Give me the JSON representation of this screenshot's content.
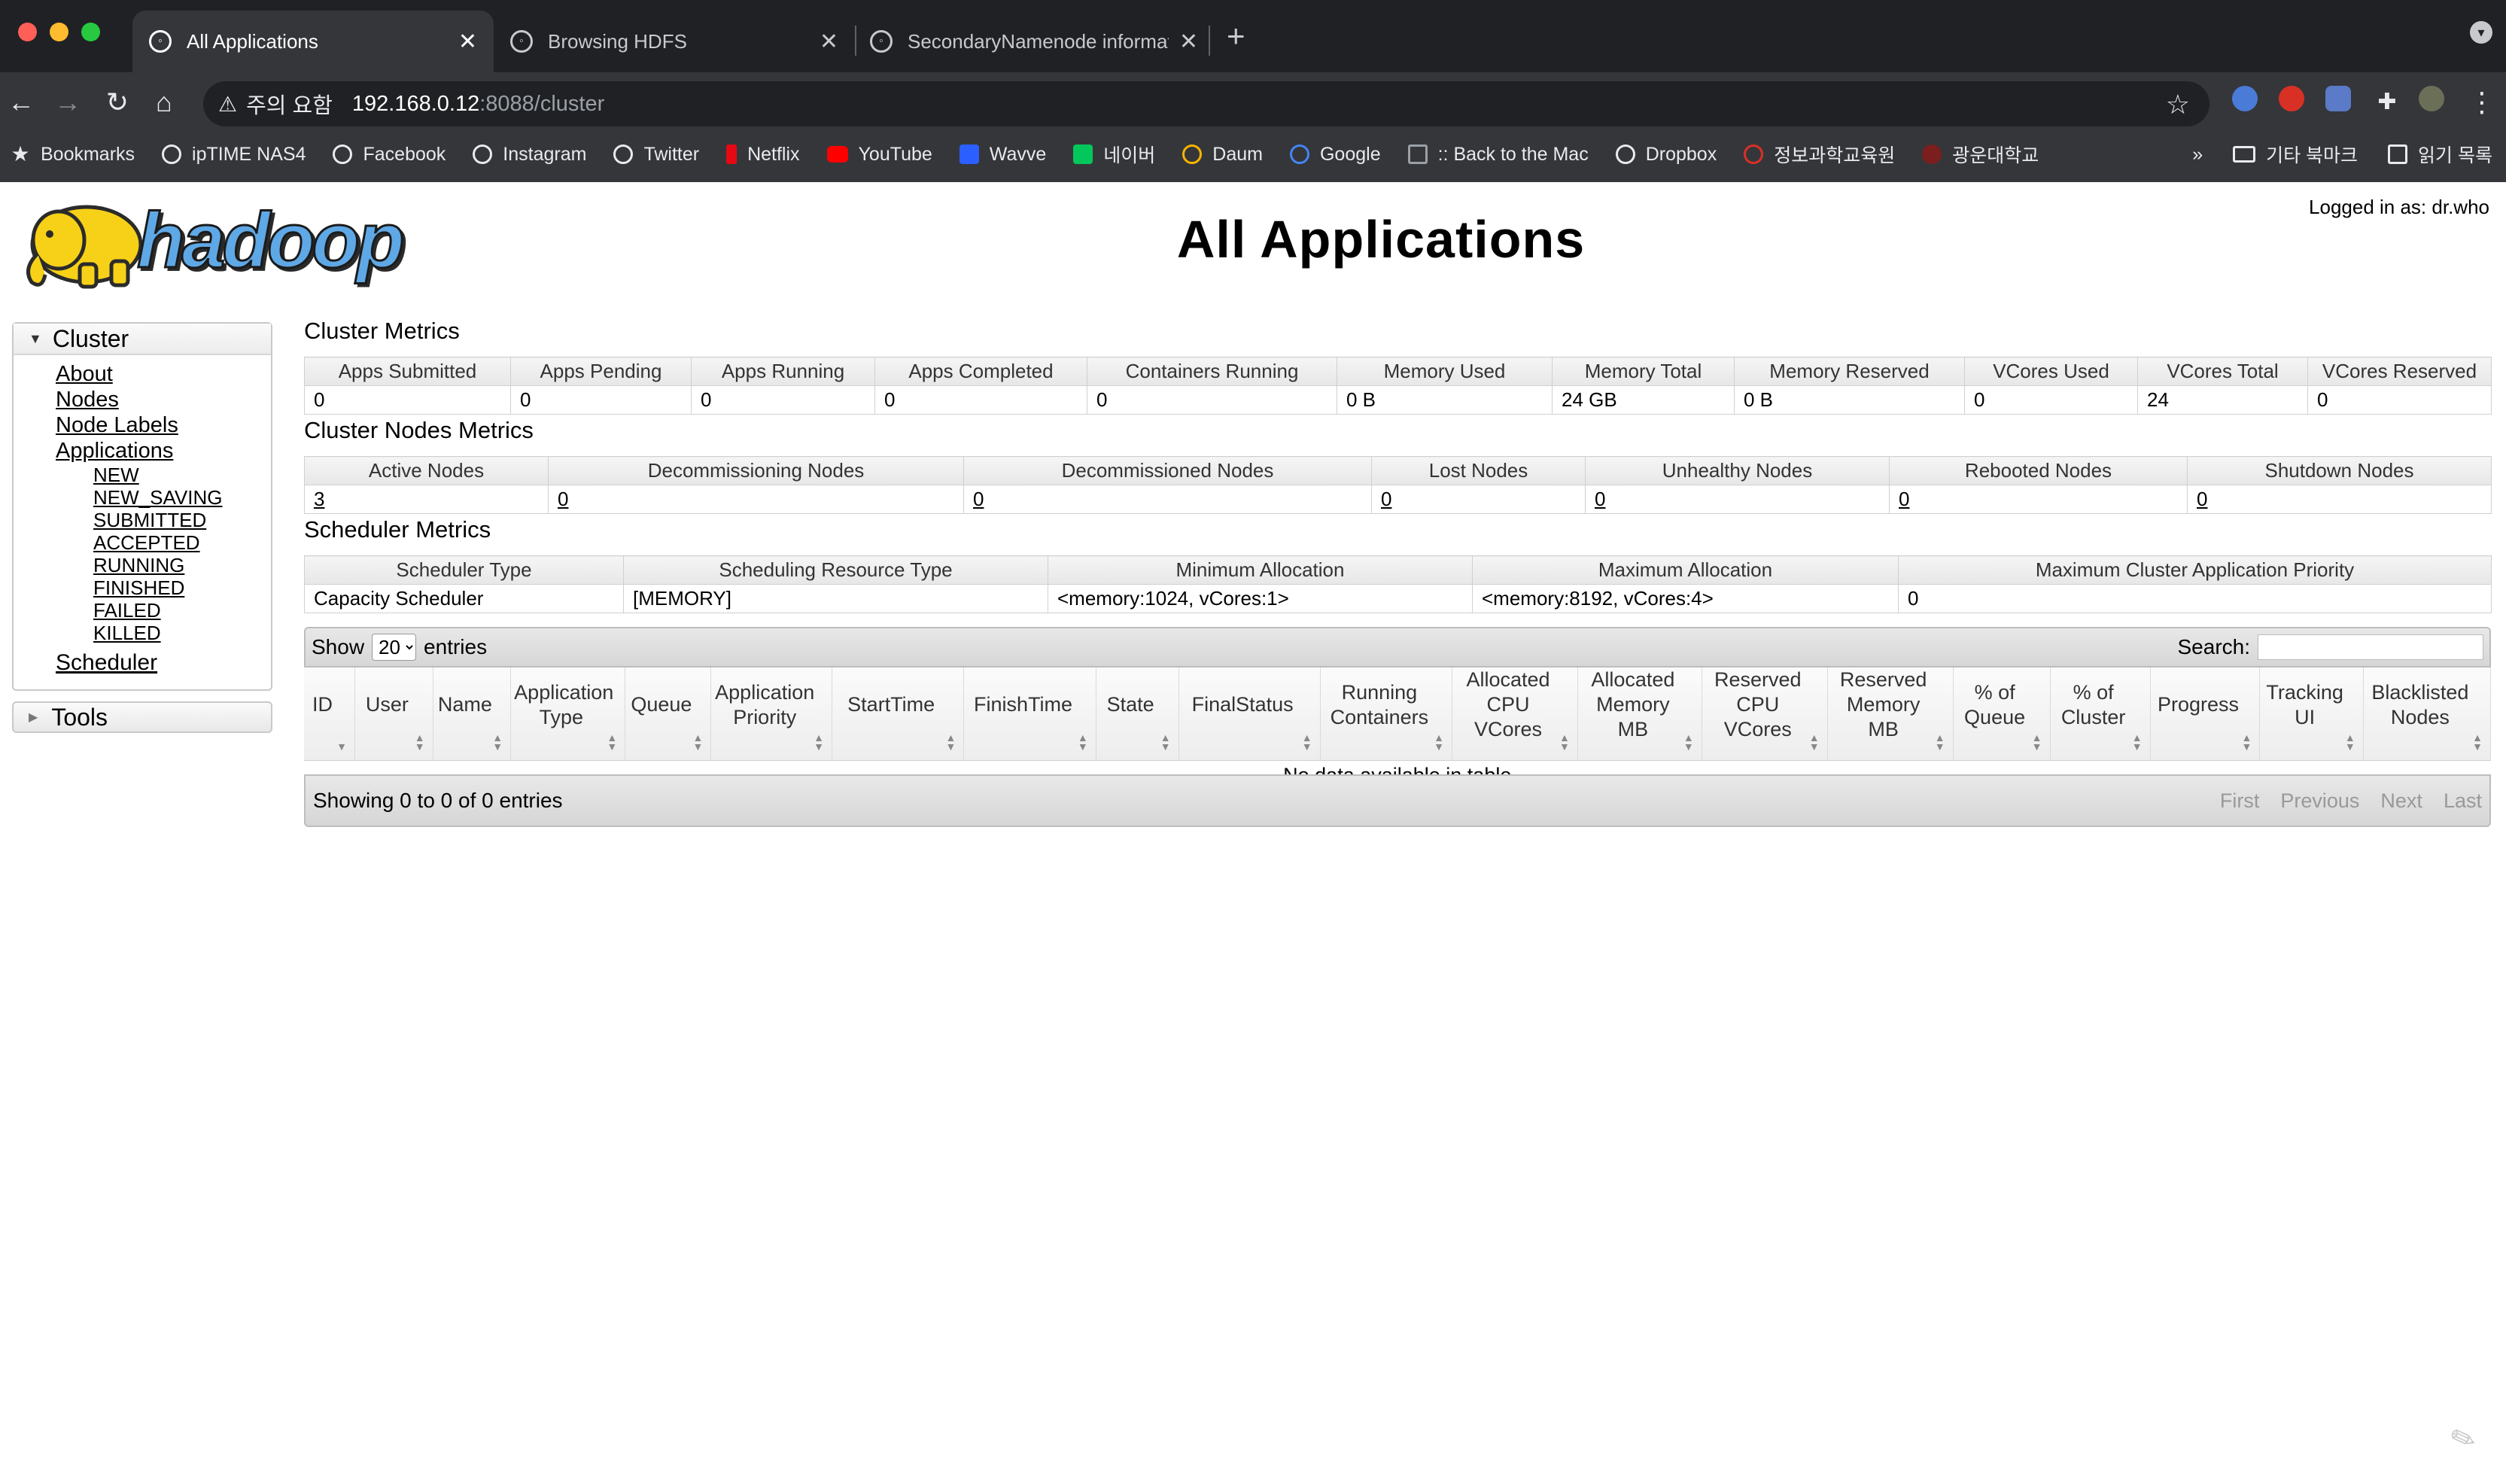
{
  "browser": {
    "tabs": [
      {
        "title": "All Applications",
        "active": true
      },
      {
        "title": "Browsing HDFS",
        "active": false
      },
      {
        "title": "SecondaryNamenode informat",
        "active": false
      }
    ],
    "new_tab_label": "+",
    "security_label": "주의 요함",
    "url_host": "192.168.0.12",
    "url_rest": ":8088/cluster",
    "bookmarks": [
      "Bookmarks",
      "ipTIME NAS4",
      "Facebook",
      "Instagram",
      "Twitter",
      "Netflix",
      "YouTube",
      "Wavve",
      "네이버",
      "Daum",
      "Google",
      ":: Back to the Mac",
      "Dropbox",
      "정보과학교육원",
      "광운대학교"
    ],
    "bookmarks_overflow": "»",
    "other_bookmarks": "기타 북마크",
    "reading_list": "읽기 목록"
  },
  "page": {
    "title": "All Applications",
    "logged_in": "Logged in as: dr.who"
  },
  "sidebar": {
    "cluster_label": "Cluster",
    "links": [
      "About",
      "Nodes",
      "Node Labels",
      "Applications"
    ],
    "app_states": [
      "NEW",
      "NEW_SAVING",
      "SUBMITTED",
      "ACCEPTED",
      "RUNNING",
      "FINISHED",
      "FAILED",
      "KILLED"
    ],
    "scheduler_label": "Scheduler",
    "tools_label": "Tools"
  },
  "cluster_metrics": {
    "title": "Cluster Metrics",
    "headers": [
      "Apps Submitted",
      "Apps Pending",
      "Apps Running",
      "Apps Completed",
      "Containers Running",
      "Memory Used",
      "Memory Total",
      "Memory Reserved",
      "VCores Used",
      "VCores Total",
      "VCores Reserved"
    ],
    "values": [
      "0",
      "0",
      "0",
      "0",
      "0",
      "0 B",
      "24 GB",
      "0 B",
      "0",
      "24",
      "0"
    ]
  },
  "node_metrics": {
    "title": "Cluster Nodes Metrics",
    "headers": [
      "Active Nodes",
      "Decommissioning Nodes",
      "Decommissioned Nodes",
      "Lost Nodes",
      "Unhealthy Nodes",
      "Rebooted Nodes",
      "Shutdown Nodes"
    ],
    "values": [
      "3",
      "0",
      "0",
      "0",
      "0",
      "0",
      "0"
    ]
  },
  "scheduler_metrics": {
    "title": "Scheduler Metrics",
    "headers": [
      "Scheduler Type",
      "Scheduling Resource Type",
      "Minimum Allocation",
      "Maximum Allocation",
      "Maximum Cluster Application Priority"
    ],
    "values": [
      "Capacity Scheduler",
      "[MEMORY]",
      "<memory:1024, vCores:1>",
      "<memory:8192, vCores:4>",
      "0"
    ]
  },
  "apps_table": {
    "show_label": "Show",
    "entries_label": "entries",
    "page_size": "20",
    "search_label": "Search:",
    "search_value": "",
    "columns": [
      "ID",
      "User",
      "Name",
      "Application Type",
      "Queue",
      "Application Priority",
      "StartTime",
      "FinishTime",
      "State",
      "FinalStatus",
      "Running Containers",
      "Allocated CPU VCores",
      "Allocated Memory MB",
      "Reserved CPU VCores",
      "Reserved Memory MB",
      "% of Queue",
      "% of Cluster",
      "Progress",
      "Tracking UI",
      "Blacklisted Nodes"
    ],
    "empty_message": "No data available in table",
    "info": "Showing 0 to 0 of 0 entries",
    "pager": [
      "First",
      "Previous",
      "Next",
      "Last"
    ]
  }
}
